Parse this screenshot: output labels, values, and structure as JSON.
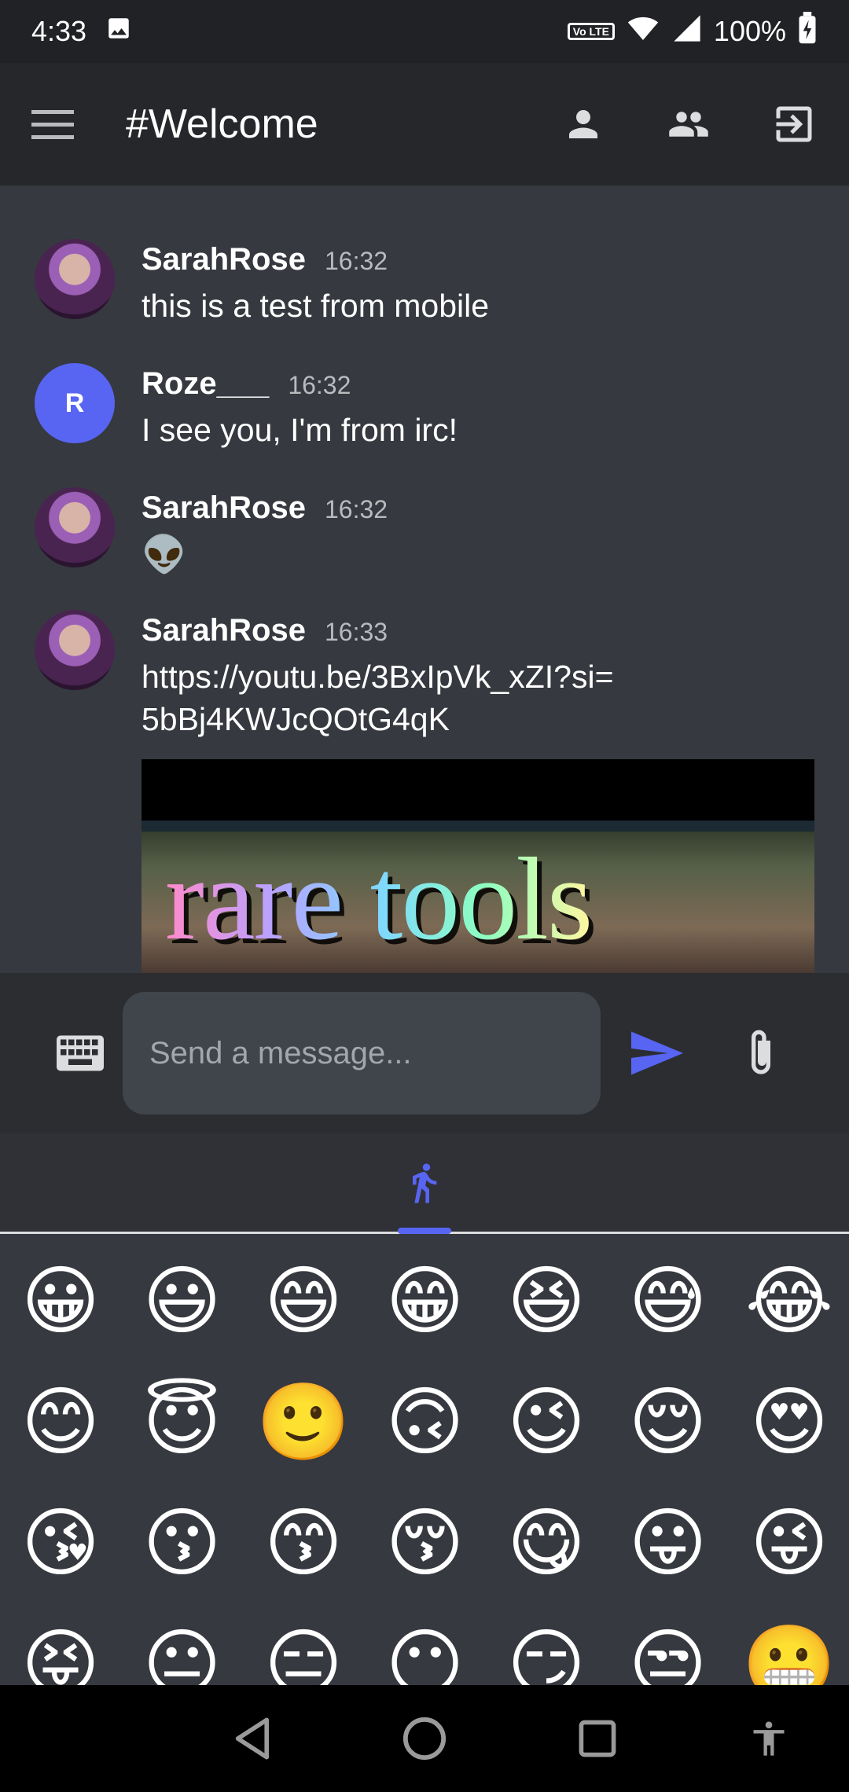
{
  "status_bar": {
    "time": "4:33",
    "volte": "Vo LTE",
    "battery": "100%",
    "icons": [
      "image-icon",
      "volte-icon",
      "wifi-icon",
      "signal-icon",
      "battery-charging-icon"
    ]
  },
  "header": {
    "menu_icon": "menu-icon",
    "title": "#Welcome",
    "actions": [
      "user-icon",
      "group-icon",
      "logout-icon"
    ]
  },
  "messages": [
    {
      "user": "SarahRose",
      "time": "16:32",
      "text": "this is a test from mobile",
      "avatar": "photo"
    },
    {
      "user": "Roze___",
      "time": "16:32",
      "text": "I see you, I'm from irc!",
      "avatar": "R"
    },
    {
      "user": "SarahRose",
      "time": "16:32",
      "text": "👽",
      "avatar": "photo"
    },
    {
      "user": "SarahRose",
      "time": "16:33",
      "text": "https://youtu.be/3BxIpVk_xZI?si=5bBj4KWJcQOtG4qK",
      "avatar": "photo"
    }
  ],
  "embed": {
    "title": "rare tools"
  },
  "composer": {
    "placeholder": "Send a message...",
    "icons": [
      "keyboard-icon",
      "send-icon",
      "attach-icon"
    ]
  },
  "emoji_picker": {
    "active_tab_icon": "people-activity-icon",
    "emojis": [
      "😀",
      "😃",
      "😄",
      "😁",
      "😆",
      "😅",
      "😂",
      "😊",
      "😇",
      "🙂",
      "🙃",
      "😉",
      "😌",
      "😍",
      "😘",
      "😗",
      "😙",
      "😚",
      "😋",
      "😛",
      "😜",
      "😝",
      "😐",
      "😑",
      "😶",
      "😏",
      "😒",
      "😬"
    ]
  },
  "nav_bar": {
    "buttons": [
      "back-icon",
      "home-icon",
      "recents-icon",
      "accessibility-icon"
    ]
  },
  "colors": {
    "accent": "#5865f2",
    "background": "#36393f",
    "header": "#26272b"
  }
}
